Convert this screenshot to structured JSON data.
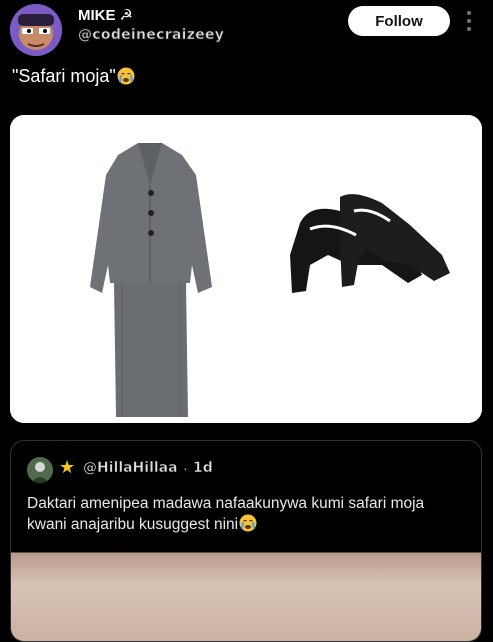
{
  "post": {
    "display_name": "MIKE",
    "name_emoji": "☭",
    "handle": "@codeinecraizeey",
    "follow_label": "Follow",
    "text": "\"Safari moja\"",
    "text_emoji": "crying-face"
  },
  "quoted": {
    "star": "★",
    "handle": "@HillaHillaa",
    "separator": "·",
    "time": "1d",
    "text": "Daktari amenipea madawa nafaakunywa kumi safari moja kwani anajaribu kusuggest nini",
    "text_emoji": "crying-face"
  },
  "colors": {
    "background": "#000000",
    "follow_bg": "#ffffff",
    "star": "#f5c518"
  },
  "icons": [
    "avatar",
    "more-vertical-icon",
    "crying-face-emoji",
    "star-icon"
  ]
}
